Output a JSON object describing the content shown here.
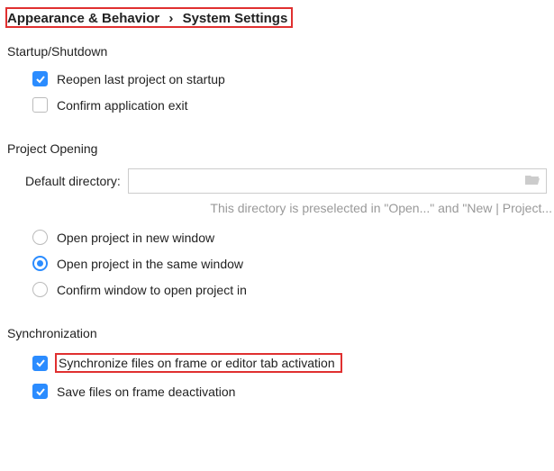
{
  "breadcrumb": {
    "parent": "Appearance & Behavior",
    "current": "System Settings"
  },
  "sections": {
    "startup": {
      "title": "Startup/Shutdown",
      "reopen_label": "Reopen last project on startup",
      "reopen_checked": true,
      "confirm_exit_label": "Confirm application exit",
      "confirm_exit_checked": false
    },
    "opening": {
      "title": "Project Opening",
      "directory_label": "Default directory:",
      "directory_value": "",
      "hint": "This directory is preselected in \"Open...\" and \"New | Project...",
      "radio_new_window": "Open project in new window",
      "radio_same_window": "Open project in the same window",
      "radio_confirm": "Confirm window to open project in",
      "selected": "same"
    },
    "sync": {
      "title": "Synchronization",
      "sync_frame_label": "Synchronize files on frame or editor tab activation",
      "sync_frame_checked": true,
      "save_frame_label": "Save files on frame deactivation",
      "save_frame_checked": true
    }
  }
}
